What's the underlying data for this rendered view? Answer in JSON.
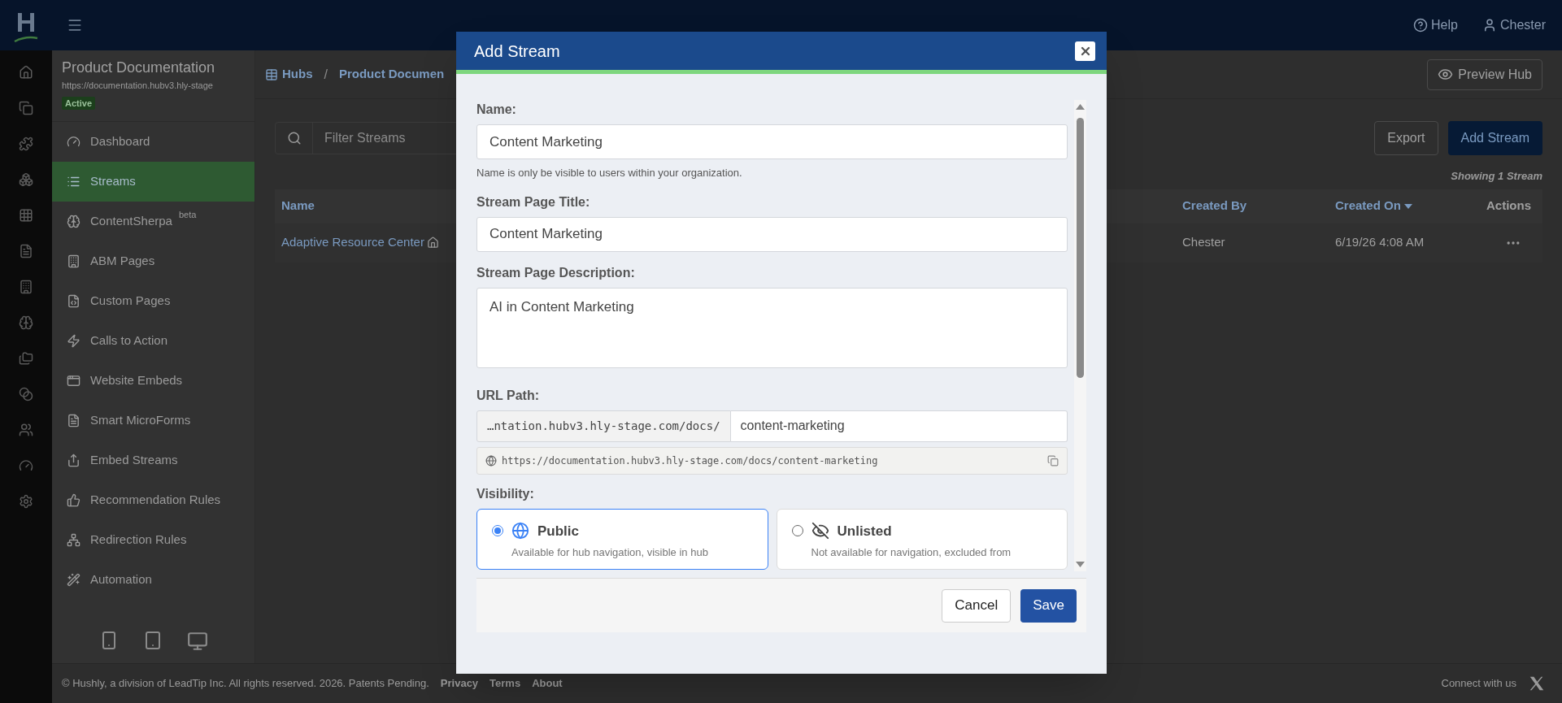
{
  "header": {
    "logo": "H",
    "help": "Help",
    "user": "Chester"
  },
  "hub": {
    "title": "Product Documentation",
    "url": "https://documentation.hubv3.hly-stage",
    "status": "Active"
  },
  "sidebar": {
    "items": [
      {
        "label": "Dashboard",
        "selected": false
      },
      {
        "label": "Streams",
        "selected": true
      },
      {
        "label": "ContentSherpa",
        "badge": "beta",
        "selected": false
      },
      {
        "label": "ABM Pages",
        "selected": false
      },
      {
        "label": "Custom Pages",
        "selected": false
      },
      {
        "label": "Calls to Action",
        "selected": false
      },
      {
        "label": "Website Embeds",
        "selected": false
      },
      {
        "label": "Smart MicroForms",
        "selected": false
      },
      {
        "label": "Embed Streams",
        "selected": false
      },
      {
        "label": "Recommendation Rules",
        "selected": false
      },
      {
        "label": "Redirection Rules",
        "selected": false
      },
      {
        "label": "Automation",
        "selected": false
      }
    ]
  },
  "breadcrumb": [
    "Hubs",
    "/",
    "Product Documen"
  ],
  "preview_button": "Preview Hub",
  "filter": {
    "placeholder": "Filter Streams"
  },
  "export_button": "Export",
  "add_button": "Add Stream",
  "showing": "Showing 1 Stream",
  "table": {
    "columns": [
      {
        "label": "Name",
        "sortable": true,
        "sorted": false
      },
      {
        "label": "Created By",
        "sortable": true,
        "sorted": false
      },
      {
        "label": "Created On",
        "sortable": true,
        "sorted": true
      },
      {
        "label": "Actions",
        "sortable": false,
        "sorted": false
      }
    ],
    "rows": [
      {
        "name": "Adaptive Resource Center",
        "home": true,
        "created_by": "Chester",
        "created_on": "6/19/26 4:08 AM"
      }
    ]
  },
  "footer": {
    "copyright": "© Hushly, a division of LeadTip Inc. All rights reserved. 2026. Patents Pending.",
    "links": [
      "Privacy",
      "Terms",
      "About"
    ],
    "connect": "Connect with us"
  },
  "modal": {
    "title": "Add Stream",
    "fields": [
      {
        "kind": "text",
        "label": "Name:",
        "value": "Content Marketing",
        "help": "Name is only be visible to users within your organization."
      },
      {
        "kind": "text",
        "label": "Stream Page Title:",
        "value": "Content Marketing"
      },
      {
        "kind": "textarea",
        "label": "Stream Page Description:",
        "value": "AI in Content Marketing"
      },
      {
        "kind": "url",
        "label": "URL Path:",
        "prefix": "…ntation.hubv3.hly-stage.com/docs/",
        "value": "content-marketing",
        "full_url": "https://documentation.hubv3.hly-stage.com/docs/content-marketing"
      }
    ],
    "visibility": {
      "label": "Visibility:",
      "options": [
        {
          "kind": "public",
          "label": "Public",
          "description": "Available for hub navigation, visible in hub",
          "selected": true
        },
        {
          "kind": "unlisted",
          "label": "Unlisted",
          "description": "Not available for navigation, excluded from",
          "selected": false
        }
      ]
    },
    "cancel": "Cancel",
    "save": "Save"
  }
}
